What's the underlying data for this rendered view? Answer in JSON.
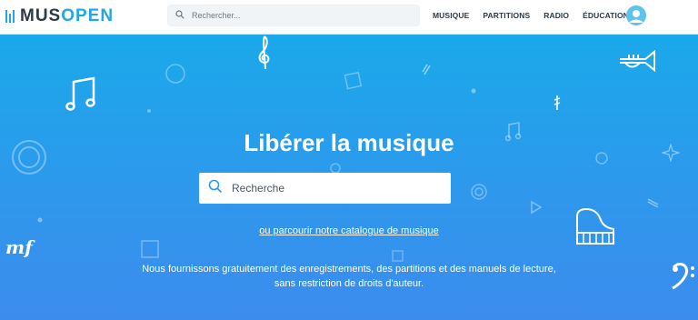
{
  "brand": {
    "logo_text_dark": "MUS",
    "logo_text_accent": "OPEN",
    "accent_color": "#22a7e0"
  },
  "header": {
    "search_placeholder": "Rechercher...",
    "nav": [
      "MUSIQUE",
      "PARTITIONS",
      "RADIO",
      "ÉDUCATION"
    ],
    "avatar_icon": "user-avatar-icon"
  },
  "hero": {
    "title": "Libérer la musique",
    "search_placeholder": "Recherche",
    "browse_link": "ou parcourir notre catalogue de musique",
    "description_line1": "Nous fournissons gratuitement des enregistrements, des partitions et des manuels de lecture,",
    "description_line2": "sans restriction de droits d'auteur.",
    "decor_text": "mf",
    "background_colors": [
      "#1aa9ea",
      "#3c8cee"
    ],
    "decor_icons": [
      "treble-clef-icon",
      "music-note-icon",
      "trumpet-icon",
      "piano-icon",
      "bass-clef-icon",
      "eighth-note-icon",
      "star-icon",
      "play-icon",
      "circle-icon",
      "square-icon"
    ]
  }
}
